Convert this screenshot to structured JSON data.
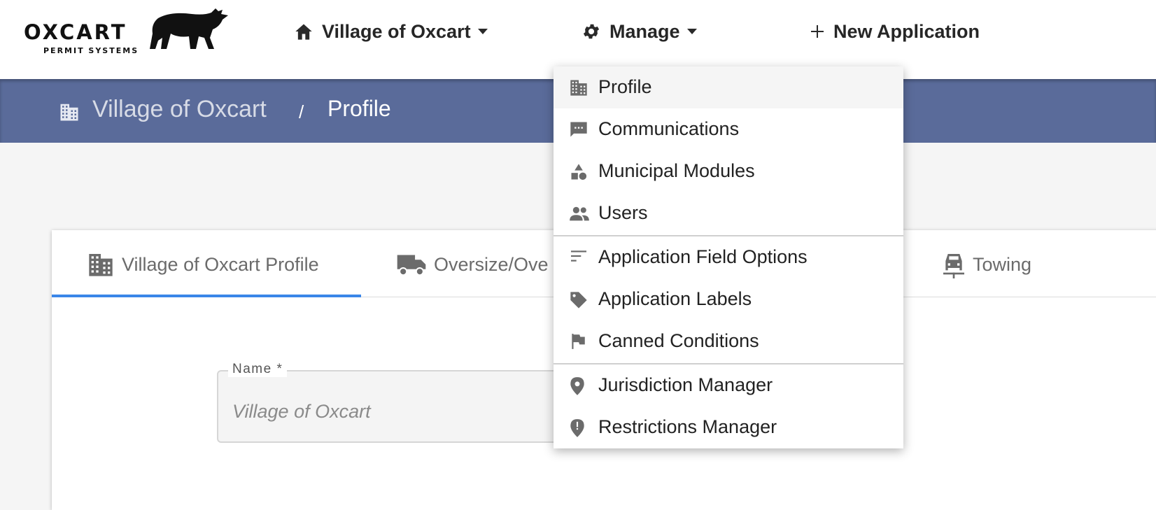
{
  "brand": {
    "name": "OXCART",
    "tagline": "PERMIT SYSTEMS"
  },
  "nav": {
    "village": "Village of Oxcart",
    "manage": "Manage",
    "new_application": "New Application"
  },
  "breadcrumb": {
    "home": "Village of Oxcart",
    "separator": "/",
    "current": "Profile"
  },
  "tabs": [
    {
      "label": "Village of Oxcart Profile",
      "icon": "building-icon",
      "active": true
    },
    {
      "label": "Oversize/Ove",
      "icon": "truck-icon"
    },
    {
      "label": "Towing",
      "icon": "car-icon"
    }
  ],
  "form": {
    "name_label": "Name *",
    "name_value": "Village of Oxcart"
  },
  "menu": {
    "items": [
      {
        "label": "Profile",
        "icon": "building-icon",
        "active": true
      },
      {
        "label": "Communications",
        "icon": "message-icon"
      },
      {
        "label": "Municipal Modules",
        "icon": "shapes-icon"
      },
      {
        "label": "Users",
        "icon": "users-icon"
      },
      {
        "label": "Application Field Options",
        "icon": "sort-lines-icon"
      },
      {
        "label": "Application Labels",
        "icon": "tag-icon"
      },
      {
        "label": "Canned Conditions",
        "icon": "flag-icon"
      },
      {
        "label": "Jurisdiction Manager",
        "icon": "location-pin-icon"
      },
      {
        "label": "Restrictions Manager",
        "icon": "alert-pin-icon"
      }
    ]
  },
  "colors": {
    "breadcrumb_bar": "#5a6b9a",
    "tab_underline": "#3a86e8",
    "icon_gray": "#6b6b6b"
  }
}
